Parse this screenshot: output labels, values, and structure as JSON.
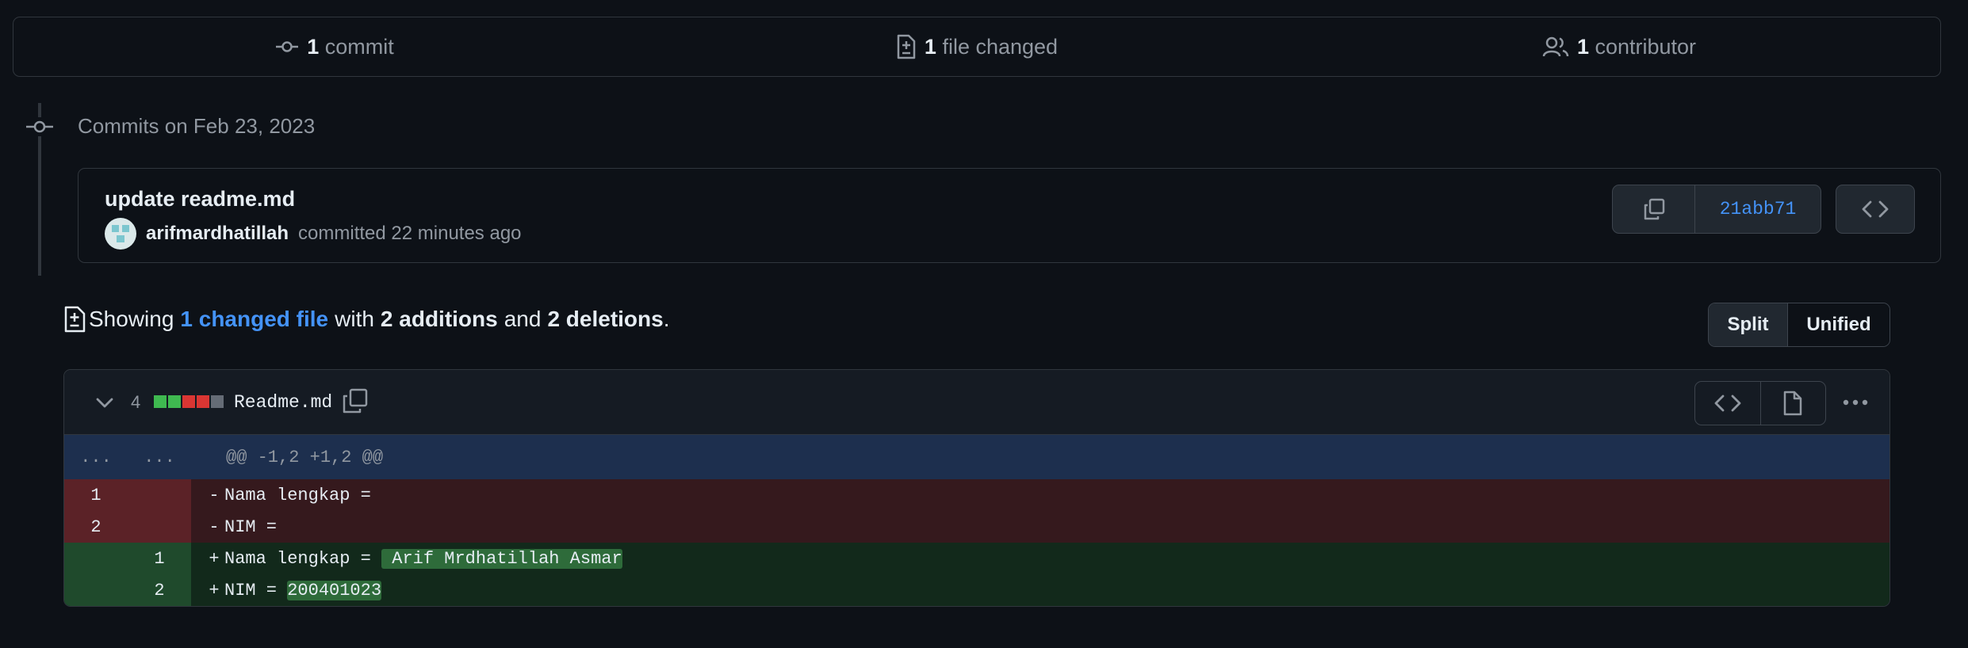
{
  "summary": {
    "commits_count": "1",
    "commits_label": "commit",
    "files_count": "1",
    "files_label": "file changed",
    "contributors_count": "1",
    "contributors_label": "contributor"
  },
  "commits_heading": "Commits on Feb 23, 2023",
  "commit": {
    "title": "update readme.md",
    "author": "arifmardhatillah",
    "action": "committed 22 minutes ago",
    "sha": "21abb71"
  },
  "showing": {
    "prefix": "Showing",
    "changed_link": "1 changed file",
    "with": "with",
    "additions": "2 additions",
    "and": "and",
    "deletions": "2 deletions",
    "period": "."
  },
  "view_toggle": {
    "split": "Split",
    "unified": "Unified",
    "selected": "Split"
  },
  "diff": {
    "change_count": "4",
    "filename": "Readme.md",
    "hunk": {
      "left": "...",
      "right": "...",
      "text": "@@ -1,2 +1,2 @@"
    },
    "lines": [
      {
        "type": "del",
        "old": "1",
        "new": "",
        "sign": "-",
        "code": "Nama lengkap =",
        "hl": ""
      },
      {
        "type": "del",
        "old": "2",
        "new": "",
        "sign": "-",
        "code": "NIM =",
        "hl": ""
      },
      {
        "type": "add",
        "old": "",
        "new": "1",
        "sign": "+",
        "code": "Nama lengkap = ",
        "hl": " Arif Mrdhatillah Asmar"
      },
      {
        "type": "add",
        "old": "",
        "new": "2",
        "sign": "+",
        "code": "NIM = ",
        "hl": "200401023"
      }
    ]
  },
  "colors": {
    "accent": "#4493f8",
    "added": "#3fb950",
    "deleted": "#da3633",
    "neutral": "#656c76"
  }
}
